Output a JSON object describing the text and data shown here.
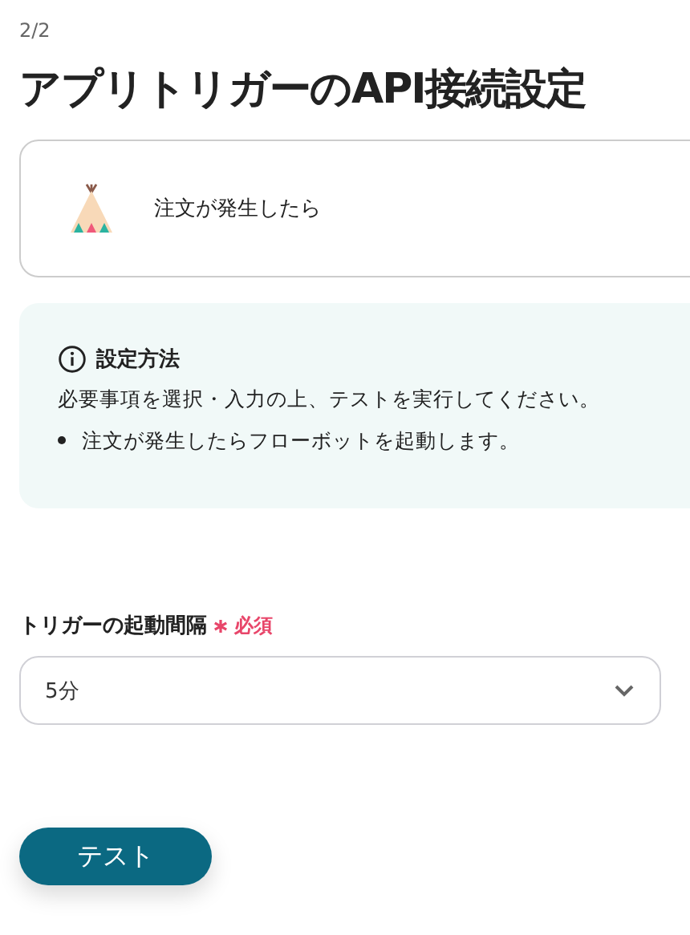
{
  "step": "2/2",
  "title": "アプリトリガーのAPI接続設定",
  "trigger": {
    "label": "注文が発生したら"
  },
  "info": {
    "heading": "設定方法",
    "text": "必要事項を選択・入力の上、テストを実行してください。",
    "bullets": [
      "注文が発生したらフローボットを起動します。"
    ]
  },
  "field": {
    "label": "トリガーの起動間隔",
    "required": true,
    "required_text": "必須",
    "value": "5分"
  },
  "test_button": "テスト"
}
